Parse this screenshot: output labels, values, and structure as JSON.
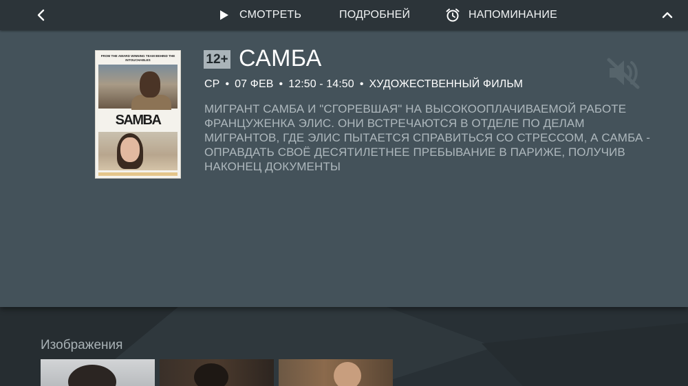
{
  "colors": {
    "background": "#2b3338",
    "panel": "#44525a",
    "topbar": "#2c3439",
    "description_text": "#aeb8bd",
    "age_badge_bg": "#aab4b9"
  },
  "header": {
    "back_icon": "chevron-left-icon",
    "actions": [
      {
        "icon": "play-icon",
        "label": "СМОТРЕТЬ"
      },
      {
        "icon": "",
        "label": "ПОДРОБНЕЙ"
      },
      {
        "icon": "alarm-clock-icon",
        "label": "НАПОМИНАНИЕ"
      }
    ],
    "collapse_icon": "chevron-up-icon"
  },
  "program": {
    "poster": {
      "tagline": "FROM THE AWARD WINNING TEAM BEHIND THE INTOUCHABLES",
      "title": "SAMBA"
    },
    "age_rating": "12+",
    "title": "САМБА",
    "meta": {
      "day": "СР",
      "separator": "•",
      "date": "07 ФЕВ",
      "time": "12:50 - 14:50",
      "genre": "ХУДОЖЕСТВЕННЫЙ ФИЛЬМ"
    },
    "description": "МИГРАНТ САМБА И \"СГОРЕВШАЯ\" НА ВЫСОКООПЛАЧИВАЕМОЙ РАБОТЕ ФРАНЦУЖЕНКА ЭЛИС. ОНИ ВСТРЕЧАЮТСЯ В ОТДЕЛЕ ПО ДЕЛАМ МИГРАНТОВ, ГДЕ ЭЛИС ПЫТАЕТСЯ СПРАВИТЬСЯ СО СТРЕССОМ, А САМБА - ОПРАВДАТЬ СВОЁ ДЕСЯТИЛЕТНЕЕ ПРЕБЫВАНИЕ В ПАРИЖЕ, ПОЛУЧИВ НАКОНЕЦ ДОКУМЕНТЫ",
    "mute_icon": "volume-off-icon"
  },
  "images_section": {
    "title": "Изображения",
    "thumbnails": [
      "image-1",
      "image-2",
      "image-3"
    ]
  }
}
